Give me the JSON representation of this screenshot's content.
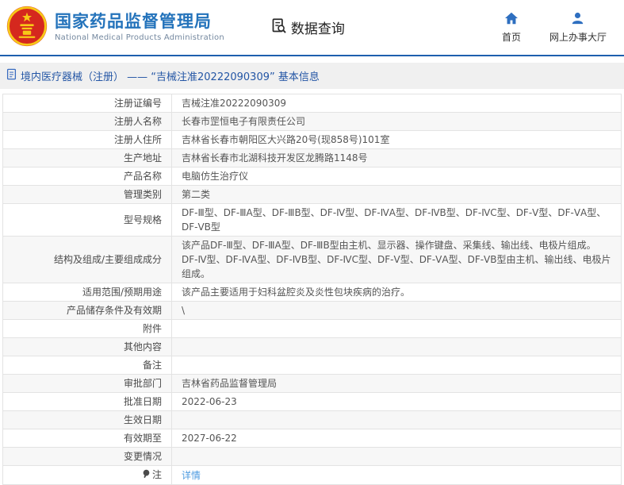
{
  "colors": {
    "brand_blue": "#2473bb",
    "header_rule_blue": "#1e5fae",
    "icon_blue": "#2e6fc0",
    "breadcrumb_text_blue": "#2456a5",
    "link_blue": "#4d9be0",
    "emblem_red": "#d5281e",
    "emblem_gold": "#f7c917"
  },
  "header": {
    "title": "国家药品监督管理局",
    "subtitle": "National Medical Products Administration",
    "section_label": "数据查询",
    "nav": [
      {
        "label": "首页",
        "icon": "home-icon"
      },
      {
        "label": "网上办事大厅",
        "icon": "user-icon"
      }
    ]
  },
  "breadcrumb": {
    "text": "境内医疗器械（注册） —— “吉械注准20222090309” 基本信息"
  },
  "table": {
    "rows": [
      {
        "label": "注册证编号",
        "value": "吉械注准20222090309"
      },
      {
        "label": "注册人名称",
        "value": "长春市罡恒电子有限责任公司"
      },
      {
        "label": "注册人住所",
        "value": "吉林省长春市朝阳区大兴路20号(现858号)101室"
      },
      {
        "label": "生产地址",
        "value": "吉林省长春市北湖科技开发区龙腾路1148号"
      },
      {
        "label": "产品名称",
        "value": "电脑仿生治疗仪"
      },
      {
        "label": "管理类别",
        "value": "第二类"
      },
      {
        "label": "型号规格",
        "value": "DF-Ⅲ型、DF-ⅢA型、DF-ⅢB型、DF-Ⅳ型、DF-ⅣA型、DF-ⅣB型、DF-ⅣC型、DF-Ⅴ型、DF-ⅤA型、DF-ⅤB型"
      },
      {
        "label": "结构及组成/主要组成成分",
        "value": "该产品DF-Ⅲ型、DF-ⅢA型、DF-ⅢB型由主机、显示器、操作键盘、采集线、输出线、电极片组成。",
        "value2": "DF-Ⅳ型、DF-ⅣA型、DF-ⅣB型、DF-ⅣC型、DF-Ⅴ型、DF-ⅤA型、DF-ⅤB型由主机、输出线、电极片组成。"
      },
      {
        "label": "适用范围/预期用途",
        "value": "该产品主要适用于妇科盆腔炎及炎性包块疾病的治疗。"
      },
      {
        "label": "产品储存条件及有效期",
        "value": "\\"
      },
      {
        "label": "附件",
        "value": ""
      },
      {
        "label": "其他内容",
        "value": ""
      },
      {
        "label": "备注",
        "value": ""
      },
      {
        "label": "审批部门",
        "value": "吉林省药品监督管理局"
      },
      {
        "label": "批准日期",
        "value": "2022-06-23"
      },
      {
        "label": "生效日期",
        "value": ""
      },
      {
        "label": "有效期至",
        "value": "2027-06-22"
      },
      {
        "label": "变更情况",
        "value": ""
      },
      {
        "label": "注",
        "value": "详情",
        "link": true,
        "label_icon": "pin-icon"
      }
    ]
  }
}
